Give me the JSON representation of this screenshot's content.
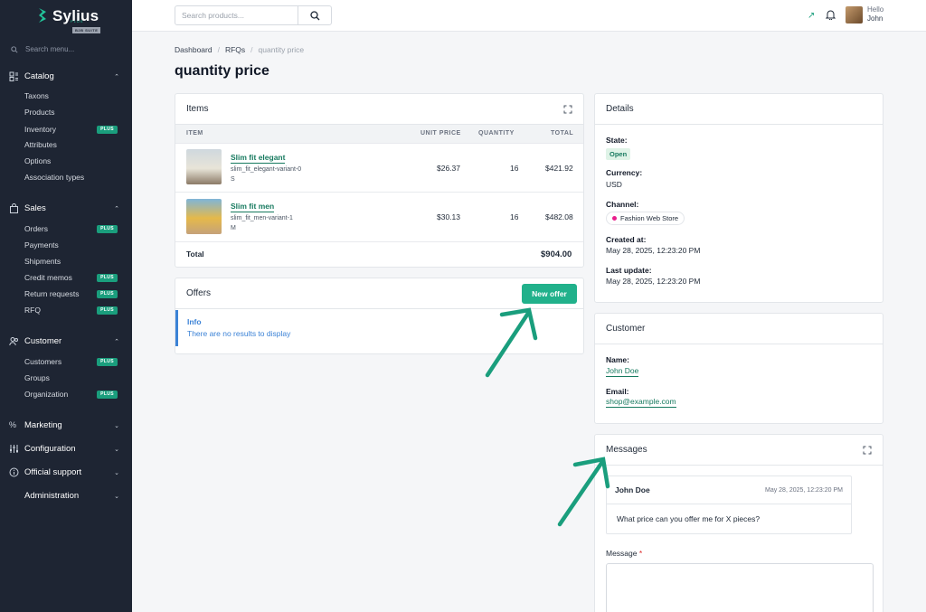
{
  "sidebar": {
    "brand": "Sylius",
    "brand_plus": "PLUS",
    "brand_suite": "B2B SUITE",
    "search_placeholder": "Search menu...",
    "plus_badge": "PLUS",
    "catalog": {
      "label": "Catalog",
      "items": [
        "Taxons",
        "Products",
        "Inventory",
        "Attributes",
        "Options",
        "Association types"
      ]
    },
    "sales": {
      "label": "Sales",
      "items": [
        "Orders",
        "Payments",
        "Shipments",
        "Credit memos",
        "Return requests",
        "RFQ"
      ]
    },
    "customer": {
      "label": "Customer",
      "items": [
        "Customers",
        "Groups",
        "Organization"
      ]
    },
    "marketing": "Marketing",
    "configuration": "Configuration",
    "support": "Official support",
    "administration": "Administration"
  },
  "topbar": {
    "search_placeholder": "Search products...",
    "hello": "Hello",
    "user": "John"
  },
  "breadcrumb": [
    "Dashboard",
    "RFQs",
    "quantity price"
  ],
  "page_title": "quantity price",
  "items": {
    "title": "Items",
    "columns": [
      "ITEM",
      "UNIT PRICE",
      "QUANTITY",
      "TOTAL"
    ],
    "rows": [
      {
        "name": "Slim fit elegant",
        "variant": "slim_fit_elegant-variant-0",
        "size": "S",
        "unit_price": "$26.37",
        "quantity": "16",
        "total": "$421.92"
      },
      {
        "name": "Slim fit men",
        "variant": "slim_fit_men-variant-1",
        "size": "M",
        "unit_price": "$30.13",
        "quantity": "16",
        "total": "$482.08"
      }
    ],
    "total_label": "Total",
    "total_value": "$904.00"
  },
  "offers": {
    "title": "Offers",
    "new_offer": "New offer",
    "info_title": "Info",
    "info_text": "There are no results to display"
  },
  "details": {
    "title": "Details",
    "state_label": "State:",
    "state": "Open",
    "currency_label": "Currency:",
    "currency": "USD",
    "channel_label": "Channel:",
    "channel": "Fashion Web Store",
    "created_label": "Created at:",
    "created": "May 28, 2025, 12:23:20 PM",
    "updated_label": "Last update:",
    "updated": "May 28, 2025, 12:23:20 PM"
  },
  "customer": {
    "title": "Customer",
    "name_label": "Name:",
    "name": "John Doe",
    "email_label": "Email:",
    "email": "shop@example.com"
  },
  "messages": {
    "title": "Messages",
    "author": "John Doe",
    "date": "May 28, 2025, 12:23:20 PM",
    "text": "What price can you offer me for X pieces?",
    "message_label": "Message",
    "required_mark": "*"
  },
  "colors": {
    "accent": "#21b18b",
    "link": "#177a5f",
    "info": "#3b82d6",
    "sidebar": "#1e2533"
  }
}
